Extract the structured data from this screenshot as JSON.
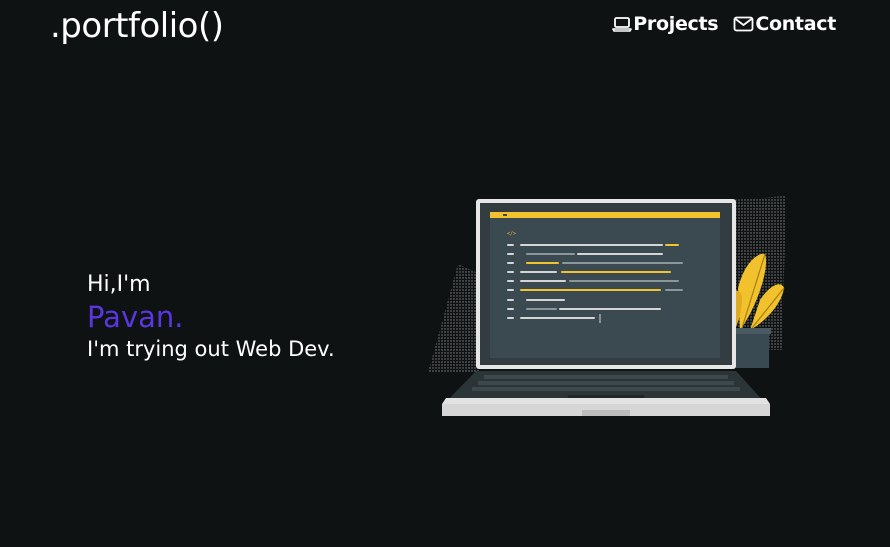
{
  "header": {
    "logo": ".portfolio()",
    "nav": [
      {
        "label": "Projects",
        "icon": "laptop-icon"
      },
      {
        "label": "Contact",
        "icon": "mail-icon"
      }
    ]
  },
  "hero": {
    "greeting": "Hi,I'm",
    "name": "Pavan.",
    "tagline": "I'm trying out Web Dev."
  },
  "colors": {
    "background": "#0f1213",
    "accent": "#5a35e0",
    "illustration_yellow": "#f2c12e"
  },
  "illustration": {
    "code_tag": "</>"
  }
}
